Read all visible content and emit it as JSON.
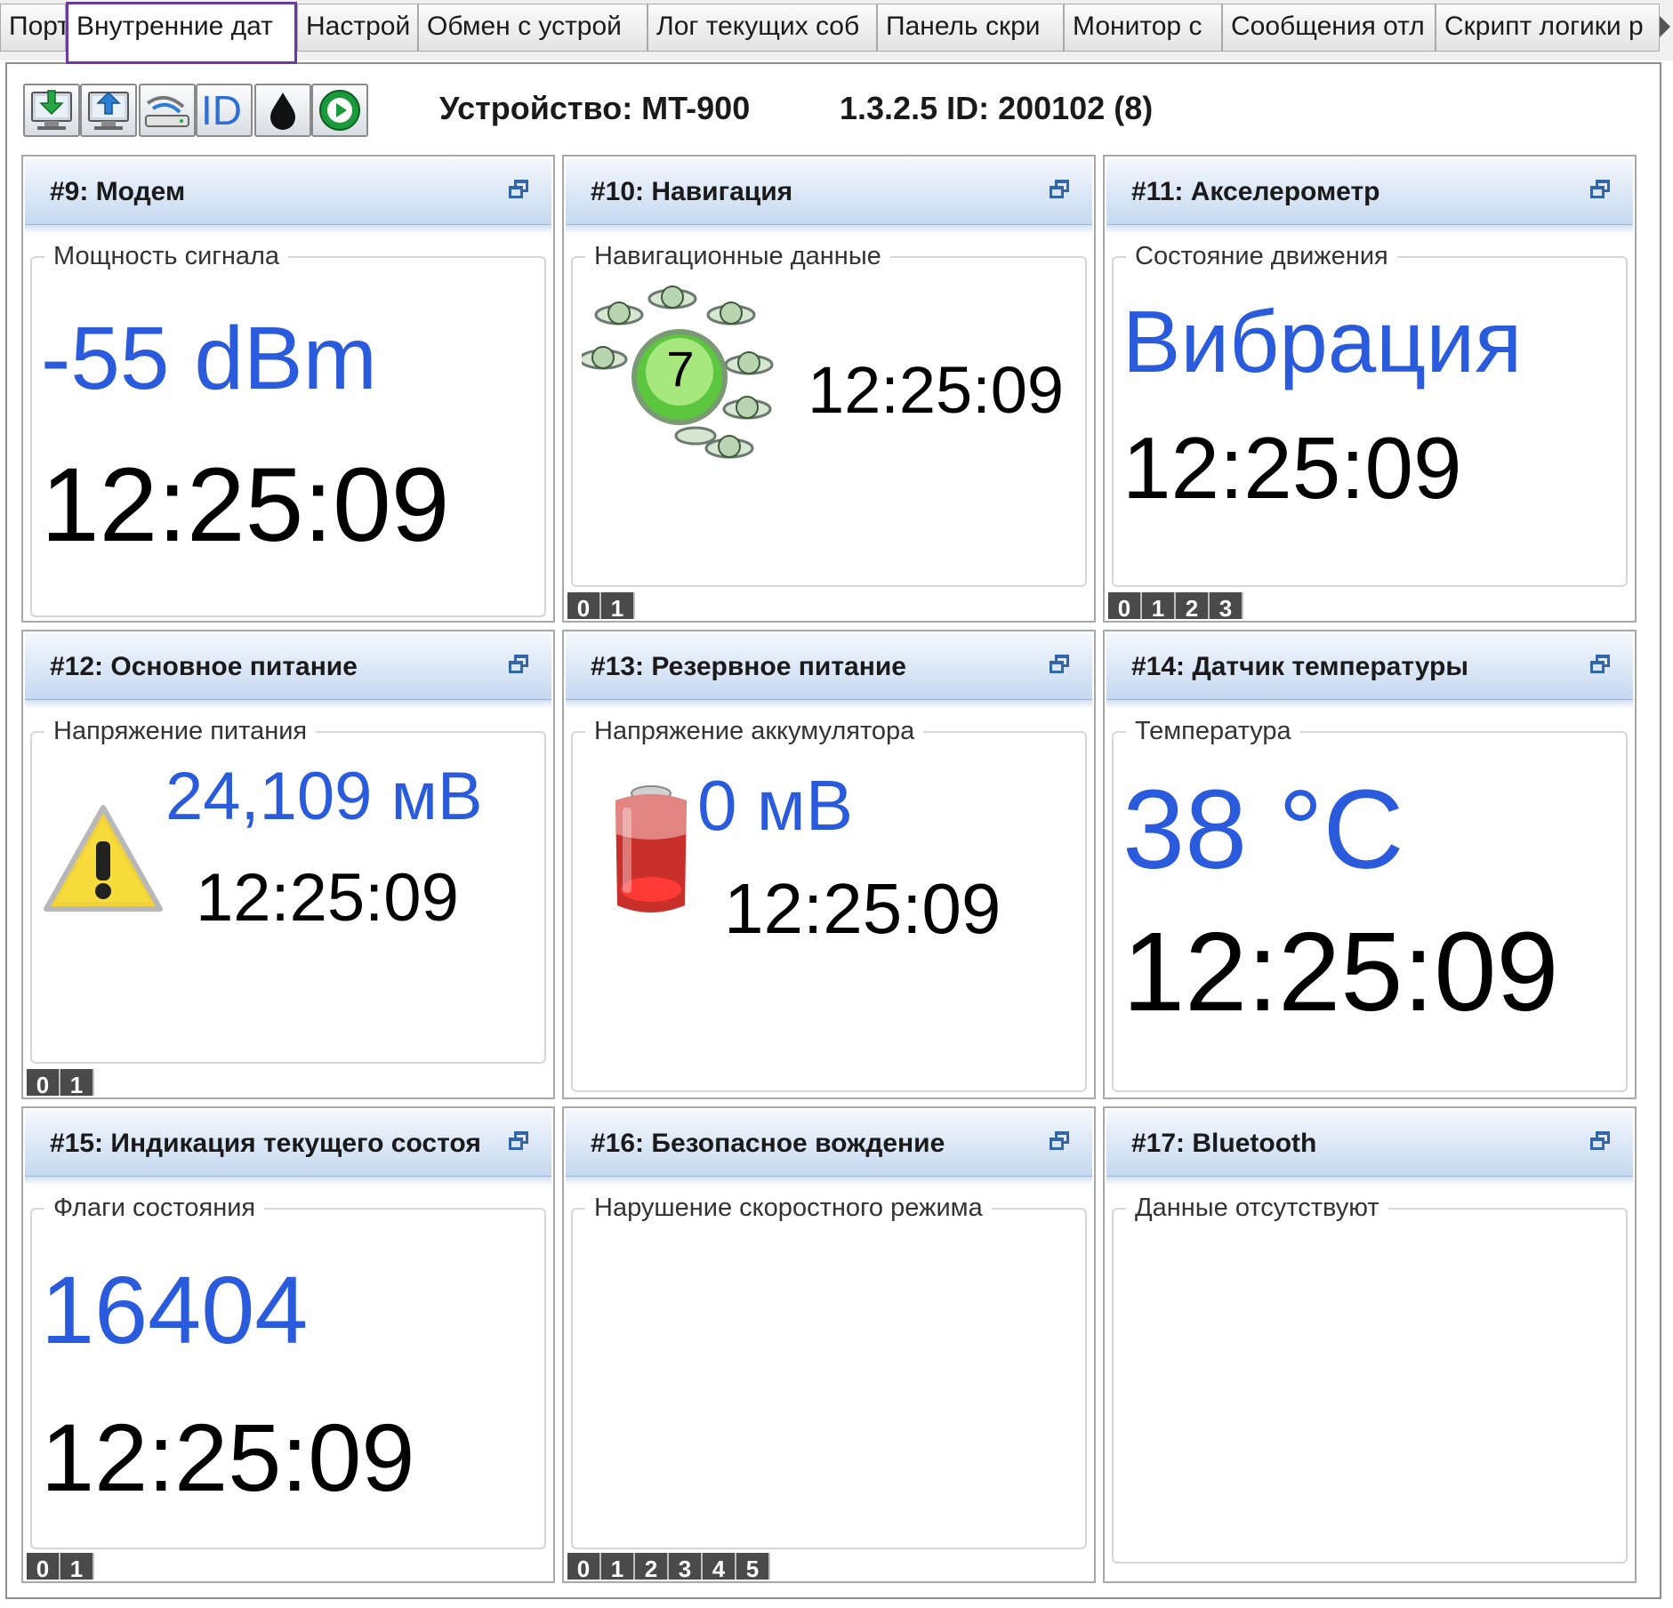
{
  "tabs": [
    {
      "label": "Порт"
    },
    {
      "label": "Внутренние дат"
    },
    {
      "label": "Настрой"
    },
    {
      "label": "Обмен с устрой"
    },
    {
      "label": "Лог текущих соб"
    },
    {
      "label": "Панель скри"
    },
    {
      "label": "Монитор с"
    },
    {
      "label": "Сообщения отл"
    },
    {
      "label": "Скрипт логики р"
    }
  ],
  "toolbar": {
    "buttons": [
      "download-icon",
      "upload-icon",
      "connection-icon",
      "id-icon",
      "drop-icon",
      "play-icon"
    ],
    "id_text": "ID",
    "device": "Устройство: MT-900",
    "version": "1.3.2.5 ID: 200102 (8)"
  },
  "widgets": {
    "w9": {
      "title": "#9: Модем",
      "group": "Мощность сигнала",
      "value": "-55 dBm",
      "time": "12:25:09",
      "pages": []
    },
    "w10": {
      "title": "#10: Навигация",
      "group": "Навигационные данные",
      "satellites": "7",
      "time": "12:25:09",
      "pages": [
        "0",
        "1"
      ]
    },
    "w11": {
      "title": "#11: Акселерометр",
      "group": "Состояние движения",
      "value": "Вибрация",
      "time": "12:25:09",
      "pages": [
        "0",
        "1",
        "2",
        "3"
      ]
    },
    "w12": {
      "title": "#12: Основное питание",
      "group": "Напряжение питания",
      "value": "24,109 мВ",
      "time": "12:25:09",
      "pages": [
        "0",
        "1"
      ]
    },
    "w13": {
      "title": "#13: Резервное питание",
      "group": "Напряжение аккумулятора",
      "value": "0 мВ",
      "time": "12:25:09",
      "pages": []
    },
    "w14": {
      "title": "#14: Датчик температуры",
      "group": "Температура",
      "value": "38 °C",
      "time": "12:25:09",
      "pages": []
    },
    "w15": {
      "title": "#15:  Индикация текущего состоя",
      "group": "Флаги состояния",
      "value": "16404",
      "time": "12:25:09",
      "pages": [
        "0",
        "1"
      ]
    },
    "w16": {
      "title": "#16: Безопасное вождение",
      "group": "Нарушение скоростного режима",
      "pages": [
        "0",
        "1",
        "2",
        "3",
        "4",
        "5"
      ]
    },
    "w17": {
      "title": "#17: Bluetooth",
      "group": "Данные отсутствуют",
      "pages": []
    }
  },
  "colors": {
    "value_blue": "#2a5bdc",
    "active_tab_border": "#6b3aa0",
    "header_blue": "#dbe7f6"
  }
}
